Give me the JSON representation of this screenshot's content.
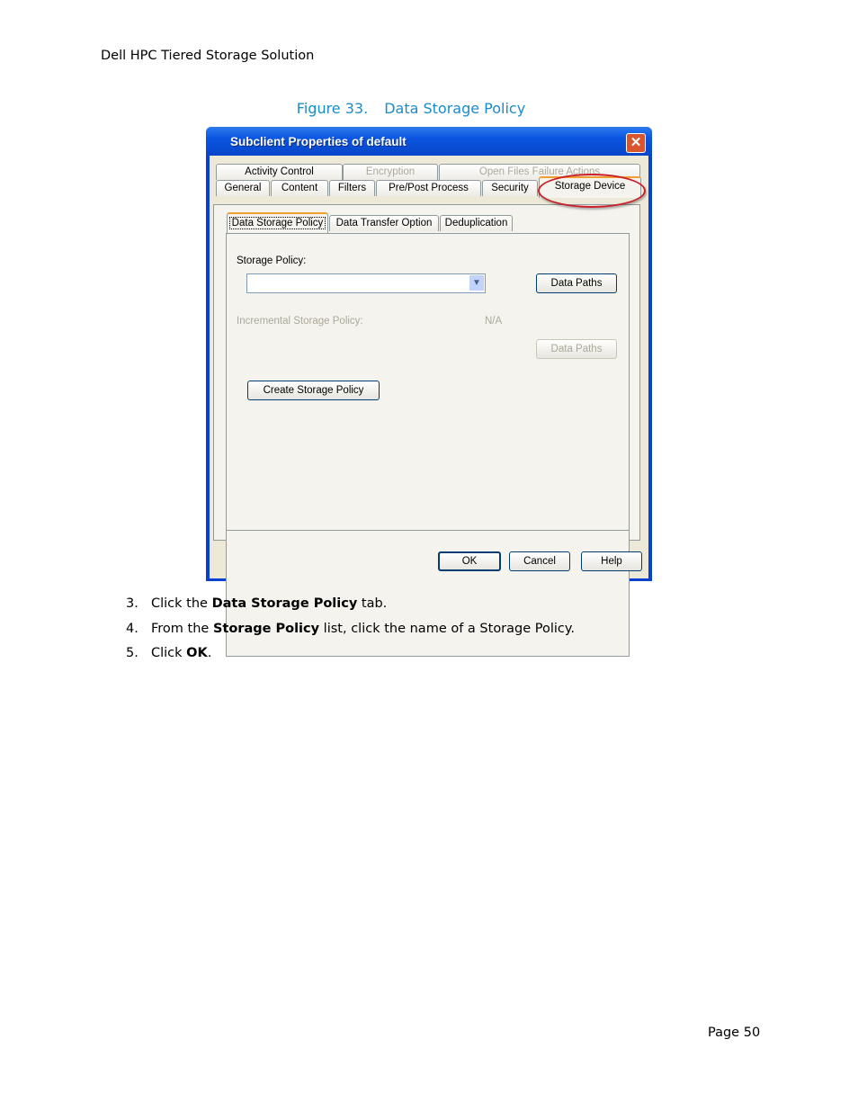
{
  "header": "Dell HPC Tiered Storage Solution",
  "figure": {
    "number": "Figure 33.",
    "title": "Data Storage Policy"
  },
  "dialog": {
    "title": "Subclient Properties of default",
    "tabs_row1": [
      {
        "label": "Activity Control",
        "enabled": true
      },
      {
        "label": "Encryption",
        "enabled": false
      },
      {
        "label": "Open Files Failure Actions",
        "enabled": false
      }
    ],
    "tabs_row2": [
      "General",
      "Content",
      "Filters",
      "Pre/Post Process",
      "Security",
      "Storage Device"
    ],
    "active_tab": "Storage Device",
    "subtabs": [
      "Data Storage Policy",
      "Data Transfer Option",
      "Deduplication"
    ],
    "active_subtab": "Data Storage Policy",
    "storage_policy_label": "Storage Policy:",
    "storage_policy_value": "",
    "data_paths": "Data Paths",
    "incremental_label": "Incremental Storage Policy:",
    "incremental_value": "N/A",
    "data_paths_disabled": "Data Paths",
    "create_policy": "Create Storage Policy",
    "ok": "OK",
    "cancel": "Cancel",
    "help": "Help",
    "highlight_color": "#c8202a"
  },
  "steps": [
    {
      "n": "3.",
      "pre": "Click the ",
      "bold": "Data Storage Policy",
      "post": " tab."
    },
    {
      "n": "4.",
      "pre": "From the ",
      "bold": "Storage Policy",
      "post": " list, click the name of a Storage Policy."
    },
    {
      "n": "5.",
      "pre": "Click ",
      "bold": "OK",
      "post": "."
    }
  ],
  "page": "Page 50"
}
